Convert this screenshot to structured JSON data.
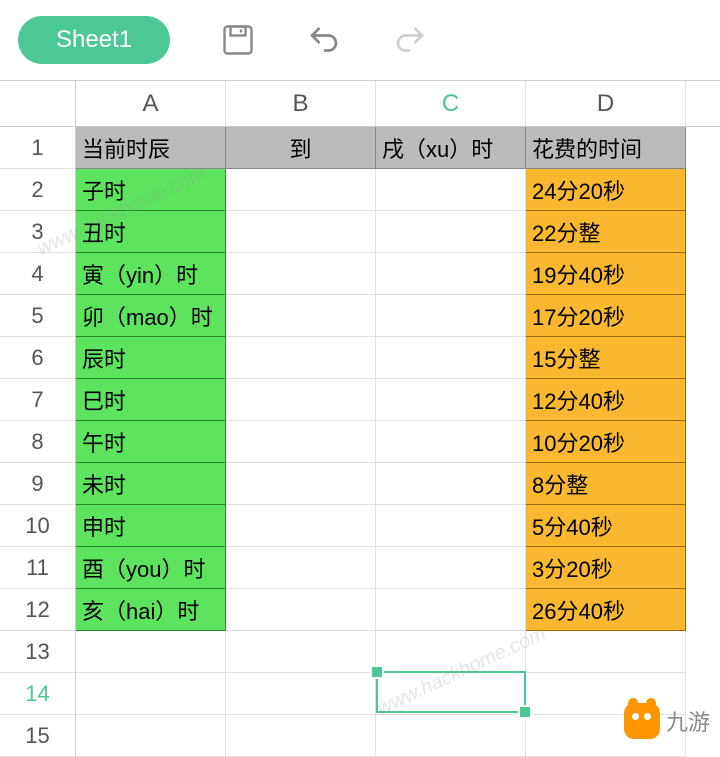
{
  "toolbar": {
    "sheet_name": "Sheet1"
  },
  "columns": [
    "A",
    "B",
    "C",
    "D"
  ],
  "row_numbers": [
    "1",
    "2",
    "3",
    "4",
    "5",
    "6",
    "7",
    "8",
    "9",
    "10",
    "11",
    "12",
    "13",
    "14",
    "15"
  ],
  "active_row": "14",
  "active_col": "C",
  "chart_data": {
    "type": "table",
    "headers": {
      "A": "当前时辰",
      "B": "到",
      "C": "戌（xu）时",
      "D": "花费的时间"
    },
    "rows": [
      {
        "A": "子时",
        "B": "",
        "C": "",
        "D": "24分20秒"
      },
      {
        "A": "丑时",
        "B": "",
        "C": "",
        "D": "22分整"
      },
      {
        "A": "寅（yin）时",
        "B": "",
        "C": "",
        "D": "19分40秒"
      },
      {
        "A": "卯（mao）时",
        "B": "",
        "C": "",
        "D": "17分20秒"
      },
      {
        "A": "辰时",
        "B": "",
        "C": "",
        "D": "15分整"
      },
      {
        "A": "巳时",
        "B": "",
        "C": "",
        "D": "12分40秒"
      },
      {
        "A": "午时",
        "B": "",
        "C": "",
        "D": "10分20秒"
      },
      {
        "A": "未时",
        "B": "",
        "C": "",
        "D": "8分整"
      },
      {
        "A": "申时",
        "B": "",
        "C": "",
        "D": "5分40秒"
      },
      {
        "A": "酉（you）时",
        "B": "",
        "C": "",
        "D": "3分20秒"
      },
      {
        "A": "亥（hai）时",
        "B": "",
        "C": "",
        "D": "26分40秒"
      }
    ]
  },
  "watermarks": [
    "www.hackhome.com",
    "www.hackhome.com"
  ],
  "logo_text": "九游"
}
